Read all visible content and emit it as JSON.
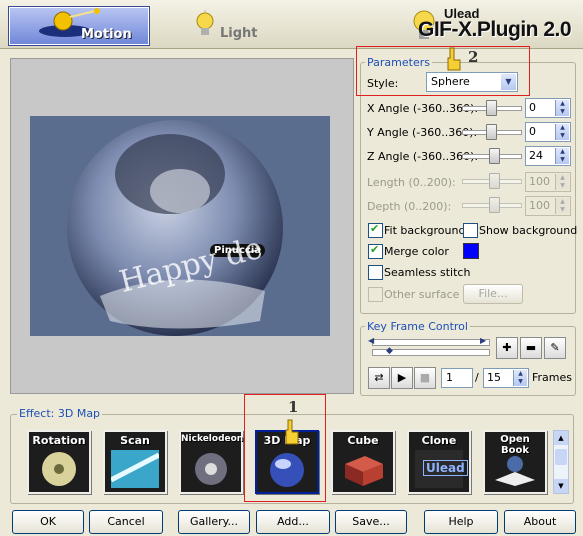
{
  "header": {
    "tabs": [
      {
        "label": "Motion"
      },
      {
        "label": "Light"
      }
    ],
    "brand_small": "Ulead",
    "brand": "GIF-X.Plugin 2.0"
  },
  "preview": {
    "overlay_name": "Pinuccia",
    "overlay_text": "Happy de"
  },
  "parameters": {
    "title": "Parameters",
    "style_label": "Style:",
    "style_value": "Sphere",
    "x_angle": {
      "label": "X Angle (-360..360):",
      "value": "0"
    },
    "y_angle": {
      "label": "Y Angle (-360..360):",
      "value": "0"
    },
    "z_angle": {
      "label": "Z Angle (-360..360):",
      "value": "24"
    },
    "length": {
      "label": "Length (0..200):",
      "value": "100"
    },
    "depth": {
      "label": "Depth (0..200):",
      "value": "100"
    },
    "fit_background": "Fit background",
    "show_background": "Show background",
    "merge_color": "Merge color",
    "merge_color_value": "#0000ff",
    "seamless_stitch": "Seamless stitch",
    "other_surface": "Other surface",
    "file_button": "File..."
  },
  "keyframe": {
    "title": "Key Frame Control",
    "current_frame": "1",
    "separator": "/",
    "total_frames": "15",
    "frames_label": "Frames"
  },
  "effect": {
    "title": "Effect: 3D Map",
    "thumbnails": [
      {
        "label": "Rotation"
      },
      {
        "label": "Scan"
      },
      {
        "label": "Nickelodeon"
      },
      {
        "label": "3D Map"
      },
      {
        "label": "Cube"
      },
      {
        "label": "Clone"
      },
      {
        "label": "Open Book"
      }
    ],
    "thumb_clone_badge": "Ulead"
  },
  "annotations": {
    "marker_1": "1",
    "marker_2": "2"
  },
  "buttons": {
    "ok": "OK",
    "cancel": "Cancel",
    "gallery": "Gallery...",
    "add": "Add...",
    "save": "Save...",
    "help": "Help",
    "about": "About"
  }
}
